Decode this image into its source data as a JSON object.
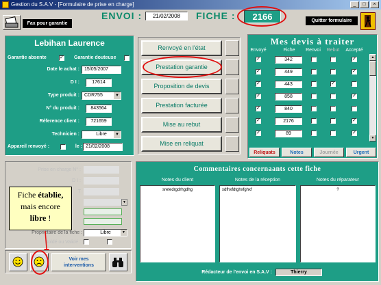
{
  "window": {
    "title": "Gestion du S.A.V - [Formulaire de prise en charge]",
    "controls": [
      "_",
      "□",
      "×"
    ]
  },
  "toolbar": {
    "fax_label": "Fax pour garantie",
    "quit_label": "Quitter formulaire"
  },
  "header": {
    "envoi_label": "ENVOI :",
    "envoi_date": "21/02/2008",
    "fiche_label": "FICHE :",
    "fiche_number": "2166"
  },
  "client": {
    "name": "Lebihan   Laurence",
    "garantie_absente_label": "Garantie absente",
    "garantie_douteuse_label": "Garantie douteuse",
    "date_achat_label": "Date le achat :",
    "date_achat": "15/05/2007",
    "di_label": "D I :",
    "di": "17614",
    "type_produit_label": "Type produit :",
    "type_produit": "CDR755",
    "num_produit_label": "N° du produit :",
    "num_produit": "843564",
    "ref_client_label": "Réference client :",
    "ref_client": "721659",
    "technicien_label": "Technicien :",
    "technicien": "Libre",
    "appareil_label": "Appareil renvoyé :",
    "le_label": "le :",
    "appareil_date": "21/02/2008"
  },
  "actions": {
    "renvoye": "Renvoyé en l'état",
    "prestation_garantie": "Prestation garantie",
    "proposition_devis": "Proposition de devis",
    "prestation_facturee": "Prestation facturée",
    "mise_au_rebut": "Mise au  rebut",
    "mise_en_reliquat": "Mise en reliquat"
  },
  "devis": {
    "title": "Mes devis à traiter",
    "columns": [
      "Envoyé",
      "Fiche",
      "Renvoi",
      "Rebut",
      "Accepté"
    ],
    "rows": [
      {
        "fiche": "342",
        "envoye": true,
        "renvoi": false,
        "rebut": false,
        "accepte": true
      },
      {
        "fiche": "449",
        "envoye": true,
        "renvoi": false,
        "rebut": false,
        "accepte": true
      },
      {
        "fiche": "443",
        "envoye": true,
        "renvoi": false,
        "rebut": true,
        "accepte": false
      },
      {
        "fiche": "858",
        "envoye": true,
        "renvoi": false,
        "rebut": false,
        "accepte": true
      },
      {
        "fiche": "840",
        "envoye": true,
        "renvoi": false,
        "rebut": false,
        "accepte": false
      },
      {
        "fiche": "2176",
        "envoye": true,
        "renvoi": false,
        "rebut": false,
        "accepte": true
      },
      {
        "fiche": "89",
        "envoye": true,
        "renvoi": false,
        "rebut": false,
        "accepte": true
      }
    ],
    "tabs": [
      "Reliquats",
      "Notes",
      "Journée",
      "Urgent"
    ],
    "tab_colors": [
      "#c01010",
      "#1a6ab8",
      "#a0a0a0",
      "#1a6ab8"
    ]
  },
  "prise": {
    "prise_label": "Prise en charge N° :",
    "di_label": "D I :",
    "type_label": "T",
    "proprietaire_label": "Propriétaire de la fiche :",
    "proprietaire": "Libre",
    "solde_label": "Soldé ou Validé :"
  },
  "tooltip": {
    "line1": "Fiche ",
    "line1_bold": "établie,",
    "line2": "mais encore",
    "line3_bold": "libre",
    "line3": " !"
  },
  "bottom": {
    "voir_label_1": "Voir mes",
    "voir_label_2": "interventions"
  },
  "comments": {
    "title": "Commentaires  concernaants  cette  fiche",
    "client_label": "Notes du client",
    "client_text": "sretedrgdrhgdhg",
    "reception_label": "Notes de la réception",
    "reception_text": "xdfhxfdtghxfghxf",
    "reparateur_label": "Notes du réparateur",
    "reparateur_text": "?",
    "redacteur_label": "Rédacteur de l'envoi en S.A.V :",
    "redacteur": "Thierry"
  },
  "colors": {
    "teal": "#1e9e86",
    "title_green": "#0c8a6a",
    "highlight": "#e01010"
  }
}
